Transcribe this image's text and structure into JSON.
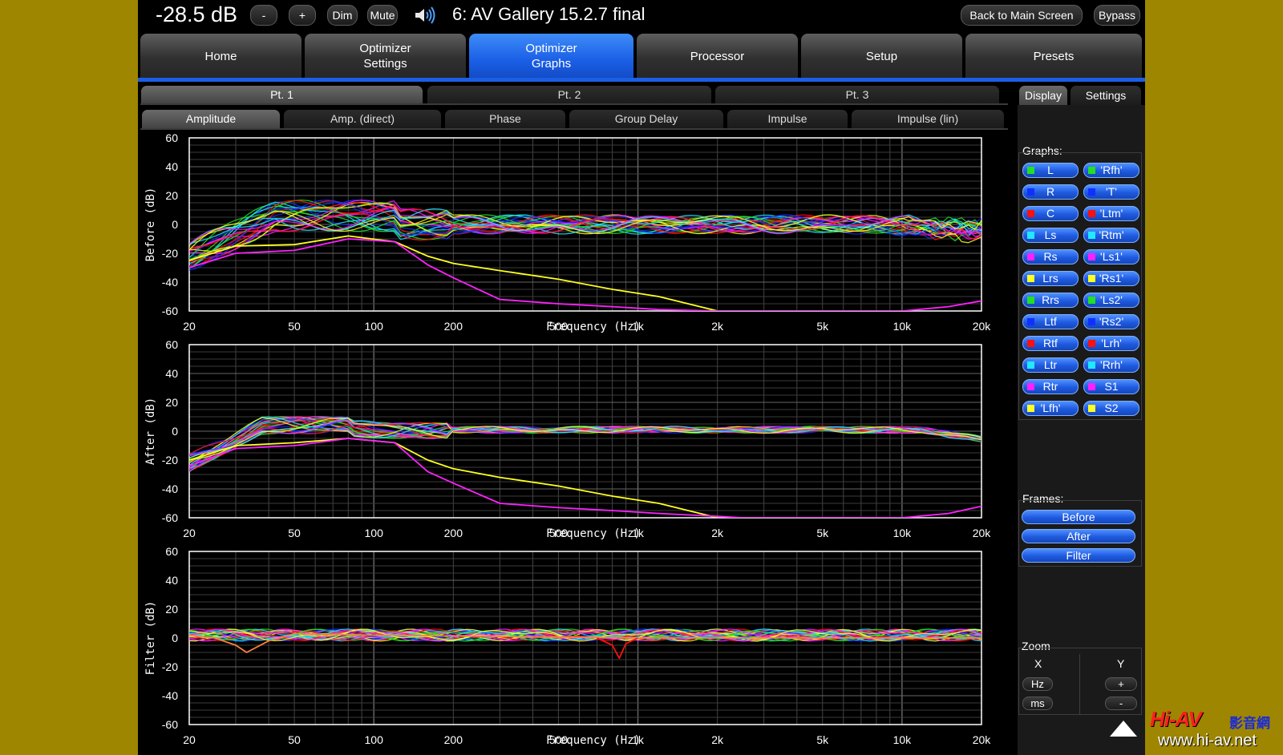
{
  "header": {
    "volume": "-28.5 dB",
    "minus_label": "-",
    "plus_label": "+",
    "dim_label": "Dim",
    "mute_label": "Mute",
    "speaker_icon": "speaker-icon",
    "preset_name": "6: AV Gallery 15.2.7 final",
    "back_label": "Back to Main Screen",
    "bypass_label": "Bypass"
  },
  "nav": {
    "tabs": [
      {
        "label": "Home"
      },
      {
        "label": "Optimizer\nSettings"
      },
      {
        "label": "Optimizer\nGraphs",
        "active": true
      },
      {
        "label": "Processor"
      },
      {
        "label": "Setup"
      },
      {
        "label": "Presets"
      }
    ]
  },
  "points": {
    "tabs": [
      {
        "label": "Pt. 1",
        "active": true
      },
      {
        "label": "Pt. 2"
      },
      {
        "label": "Pt. 3"
      }
    ]
  },
  "graph_tabs": [
    {
      "label": "Amplitude",
      "active": true
    },
    {
      "label": "Amp. (direct)"
    },
    {
      "label": "Phase"
    },
    {
      "label": "Group Delay"
    },
    {
      "label": "Impulse"
    },
    {
      "label": "Impulse (lin)"
    }
  ],
  "right_tabs": {
    "display": "Display",
    "settings": "Settings"
  },
  "graphs_panel": {
    "title": "Graphs:",
    "left": [
      {
        "label": "L",
        "color": "#22e022"
      },
      {
        "label": "R",
        "color": "#1030ff"
      },
      {
        "label": "C",
        "color": "#ff1010"
      },
      {
        "label": "Ls",
        "color": "#20e8ff"
      },
      {
        "label": "Rs",
        "color": "#ff20ff"
      },
      {
        "label": "Lrs",
        "color": "#ffff20"
      },
      {
        "label": "Rrs",
        "color": "#22e022"
      },
      {
        "label": "Ltf",
        "color": "#1030ff"
      },
      {
        "label": "Rtf",
        "color": "#ff1010"
      },
      {
        "label": "Ltr",
        "color": "#20e8ff"
      },
      {
        "label": "Rtr",
        "color": "#ff20ff"
      },
      {
        "label": "'Lfh'",
        "color": "#ffff20"
      }
    ],
    "right": [
      {
        "label": "'Rfh'",
        "color": "#22e022"
      },
      {
        "label": "'T'",
        "color": "#1030ff"
      },
      {
        "label": "'Ltm'",
        "color": "#ff1010"
      },
      {
        "label": "'Rtm'",
        "color": "#20e8ff"
      },
      {
        "label": "'Ls1'",
        "color": "#ff20ff"
      },
      {
        "label": "'Rs1'",
        "color": "#ffff20"
      },
      {
        "label": "'Ls2'",
        "color": "#22e022"
      },
      {
        "label": "'Rs2'",
        "color": "#1030ff"
      },
      {
        "label": "'Lrh'",
        "color": "#ff1010"
      },
      {
        "label": "'Rrh'",
        "color": "#20e8ff"
      },
      {
        "label": "S1",
        "color": "#ff20ff"
      },
      {
        "label": "S2",
        "color": "#ffff20"
      }
    ]
  },
  "frames_panel": {
    "title": "Frames:",
    "buttons": [
      "Before",
      "After",
      "Filter"
    ]
  },
  "zoom_panel": {
    "title": "Zoom",
    "x_label": "X",
    "y_label": "Y",
    "hz_label": "Hz",
    "ms_label": "ms",
    "plus_label": "+",
    "minus_label": "-"
  },
  "watermark": {
    "logo": "Hi-AV",
    "chinese": "影音網",
    "url": "www.hi-av.net"
  },
  "chart_data": [
    {
      "type": "line",
      "ylabel": "Before (dB)",
      "xlabel": "Frequency (Hz)",
      "x_scale": "log",
      "xlim": [
        20,
        20000
      ],
      "ylim": [
        -60,
        60
      ],
      "yticks": [
        60,
        40,
        20,
        0,
        -20,
        -40,
        -60
      ],
      "xticks": [
        "20",
        "50",
        "100",
        "200",
        "500",
        "1k",
        "2k",
        "5k",
        "10k",
        "20k"
      ],
      "grid": true,
      "series": [
        {
          "color": "#ffff20",
          "x": [
            20,
            30,
            50,
            80,
            120,
            160,
            200,
            300,
            500,
            800,
            1200,
            2000
          ],
          "y": [
            -25,
            -15,
            -14,
            -8,
            -12,
            -22,
            -27,
            -32,
            -38,
            -45,
            -50,
            -60
          ]
        },
        {
          "color": "#ff20ff",
          "x": [
            20,
            30,
            50,
            80,
            120,
            160,
            200,
            300,
            500,
            800,
            1200,
            2000,
            2500,
            10000,
            15000,
            20000
          ],
          "y": [
            -30,
            -20,
            -18,
            -10,
            -12,
            -28,
            -37,
            -52,
            -55,
            -57,
            -59,
            -60,
            -60,
            -60,
            -57,
            -53
          ]
        }
      ]
    },
    {
      "type": "line",
      "ylabel": "After (dB)",
      "xlabel": "Frequency (Hz)",
      "x_scale": "log",
      "xlim": [
        20,
        20000
      ],
      "ylim": [
        -60,
        60
      ],
      "yticks": [
        60,
        40,
        20,
        0,
        -20,
        -40,
        -60
      ],
      "xticks": [
        "20",
        "50",
        "100",
        "200",
        "500",
        "1k",
        "2k",
        "5k",
        "10k",
        "20k"
      ],
      "grid": true,
      "series": [
        {
          "color": "#ffff20",
          "x": [
            20,
            30,
            50,
            80,
            120,
            160,
            200,
            300,
            500,
            800,
            1200,
            2000
          ],
          "y": [
            -20,
            -10,
            -8,
            -5,
            -8,
            -20,
            -26,
            -32,
            -38,
            -45,
            -50,
            -60
          ]
        },
        {
          "color": "#ff20ff",
          "x": [
            20,
            30,
            50,
            80,
            120,
            160,
            200,
            300,
            500,
            800,
            1200,
            2000,
            2500,
            10000,
            15000,
            20000
          ],
          "y": [
            -24,
            -12,
            -10,
            -5,
            -8,
            -28,
            -36,
            -50,
            -53,
            -55,
            -57,
            -59,
            -60,
            -60,
            -57,
            -52
          ]
        }
      ]
    },
    {
      "type": "line",
      "ylabel": "Filter (dB)",
      "xlabel": "Frequency (Hz)",
      "x_scale": "log",
      "xlim": [
        20,
        20000
      ],
      "ylim": [
        -60,
        60
      ],
      "yticks": [
        60,
        40,
        20,
        0,
        -20,
        -40,
        -60
      ],
      "xticks": [
        "20",
        "50",
        "100",
        "200",
        "500",
        "1k",
        "2k",
        "5k",
        "10k",
        "20k"
      ],
      "grid": true,
      "series": [
        {
          "color": "#ff8040",
          "x": [
            20,
            25,
            30,
            33,
            40,
            50,
            100,
            1000,
            20000
          ],
          "y": [
            2,
            0,
            -5,
            -10,
            -2,
            3,
            2,
            0,
            0
          ]
        },
        {
          "color": "#ff1010",
          "x": [
            700,
            800,
            850,
            900,
            1000
          ],
          "y": [
            0,
            -5,
            -14,
            -4,
            0
          ]
        }
      ]
    }
  ]
}
